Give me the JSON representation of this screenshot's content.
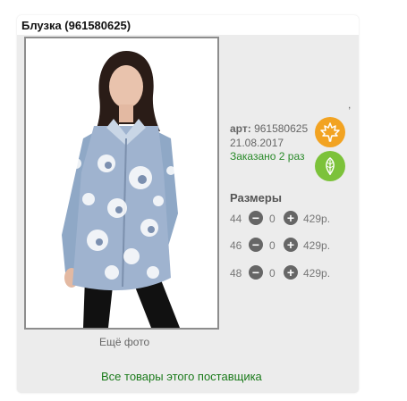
{
  "product": {
    "title": "Блузка (961580625)",
    "art_label": "арт:",
    "art_value": "961580625",
    "date": "21.08.2017",
    "ordered": "Заказано 2 раз",
    "dot": ","
  },
  "gallery": {
    "more_photos": "Ещё фото"
  },
  "sizes": {
    "title": "Размеры",
    "rows": [
      {
        "size": "44",
        "qty": "0",
        "price": "429р."
      },
      {
        "size": "46",
        "qty": "0",
        "price": "429р."
      },
      {
        "size": "48",
        "qty": "0",
        "price": "429р."
      }
    ]
  },
  "links": {
    "supplier": "Все товары этого поставщика"
  },
  "icons": {
    "season_badge_1": "maple-leaf-icon",
    "season_badge_2": "leaf-icon",
    "minus": "−",
    "plus": "+"
  },
  "colors": {
    "badge_orange": "#f2a322",
    "badge_green": "#7cc23a",
    "link_green": "#1a7a1a"
  }
}
